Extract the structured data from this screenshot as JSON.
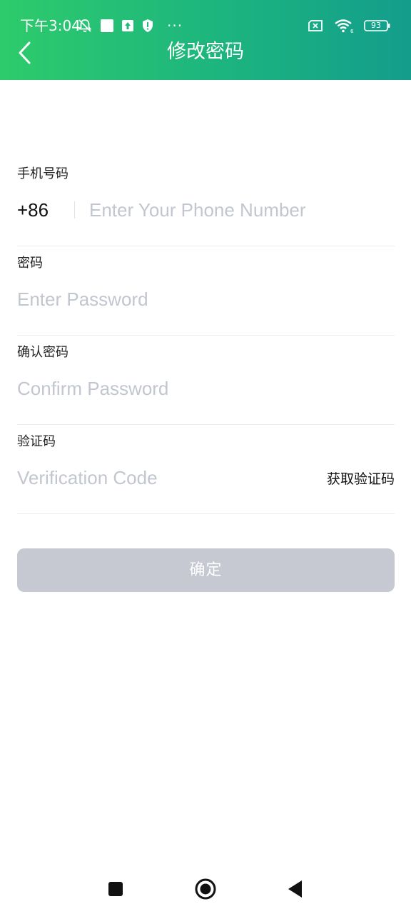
{
  "status_bar": {
    "time": "下午3:04",
    "more": "···",
    "battery": "93",
    "icons_left": [
      "bell-muted-icon",
      "square-app-icon",
      "upload-icon",
      "shield-icon"
    ],
    "icons_right": [
      "sim-error-icon",
      "wifi-icon",
      "battery-icon"
    ]
  },
  "header": {
    "title": "修改密码",
    "back_icon": "chevron-left-icon",
    "gradient_colors": [
      "#2ecb6b",
      "#139d8c"
    ]
  },
  "form": {
    "phone": {
      "label": "手机号码",
      "country_code": "+86",
      "placeholder": "Enter Your Phone Number",
      "value": ""
    },
    "password": {
      "label": "密码",
      "placeholder": "Enter Password",
      "value": ""
    },
    "confirm_password": {
      "label": "确认密码",
      "placeholder": "Confirm Password",
      "value": ""
    },
    "verification": {
      "label": "验证码",
      "placeholder": "Verification Code",
      "value": "",
      "get_code_label": "获取验证码"
    }
  },
  "confirm_button": {
    "label": "确定",
    "color": "#c6c9d2"
  },
  "nav_bar": {
    "items": [
      "recent-apps-icon",
      "home-icon",
      "back-triangle-icon"
    ]
  }
}
